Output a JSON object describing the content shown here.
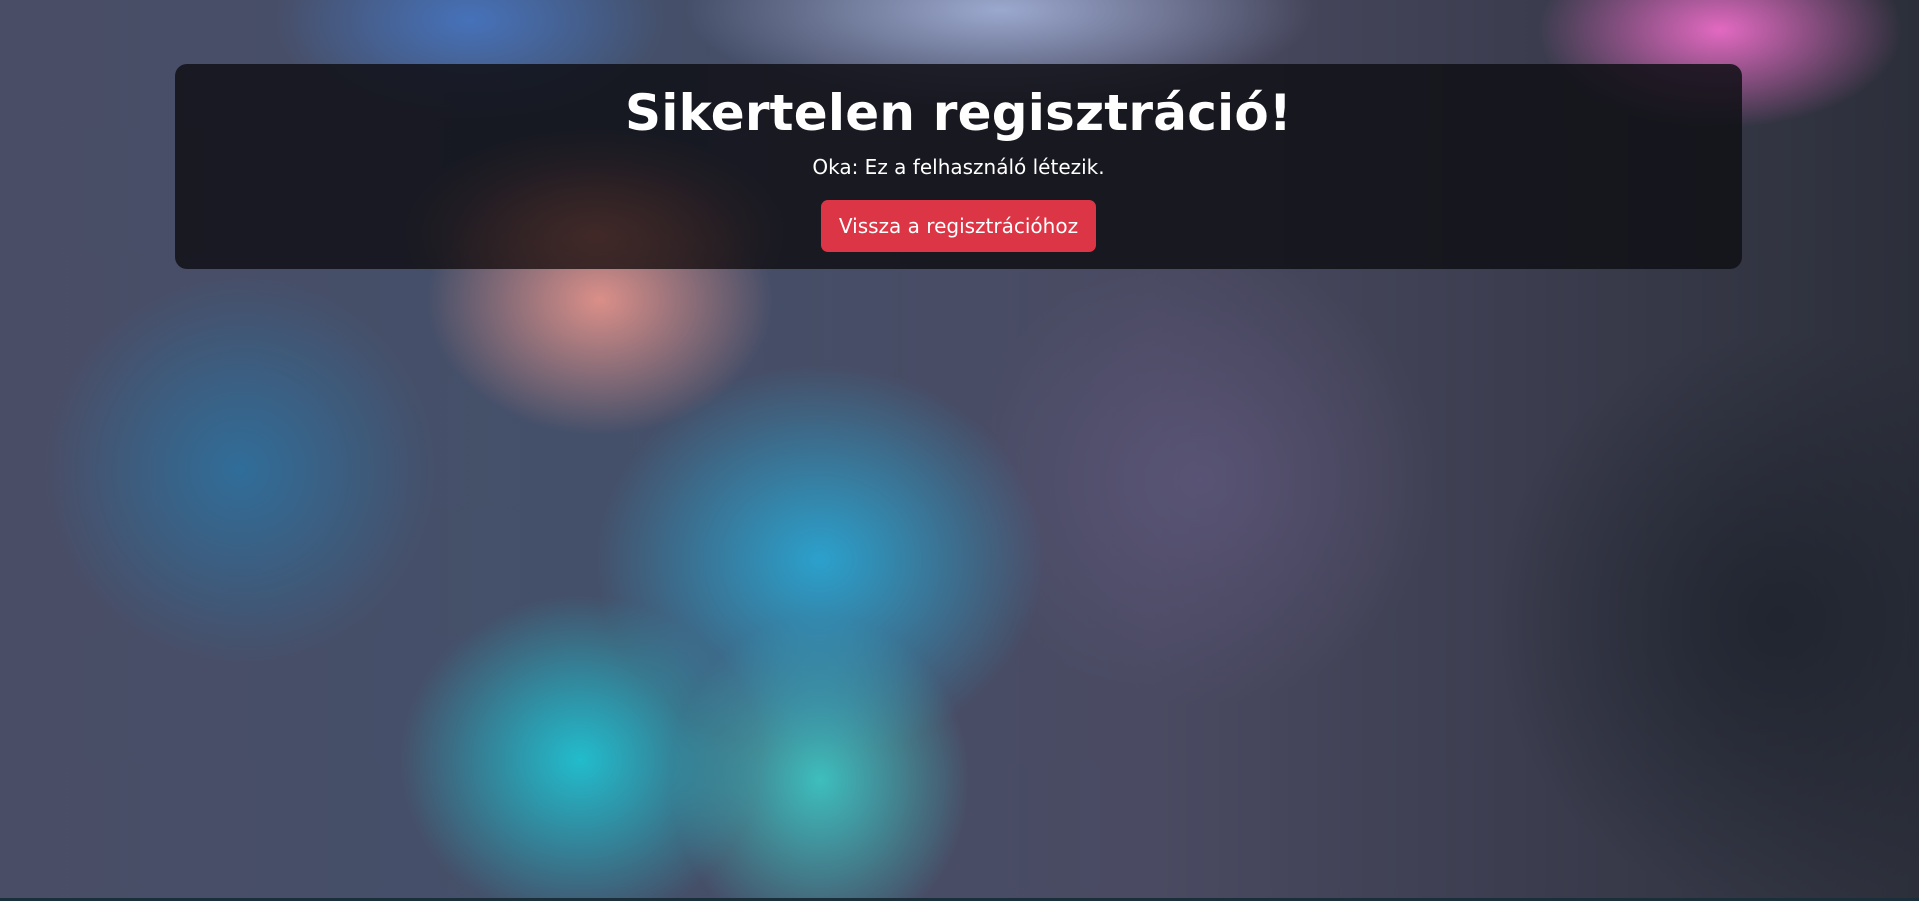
{
  "theme": {
    "accent_button": "#dc3545",
    "card_background": "rgba(16,16,22,0.86)",
    "text": "#ffffff"
  },
  "result": {
    "title": "Sikertelen regisztráció!",
    "reason": "Oka: Ez a felhasználó létezik.",
    "back_button_label": "Vissza a regisztrációhoz"
  }
}
